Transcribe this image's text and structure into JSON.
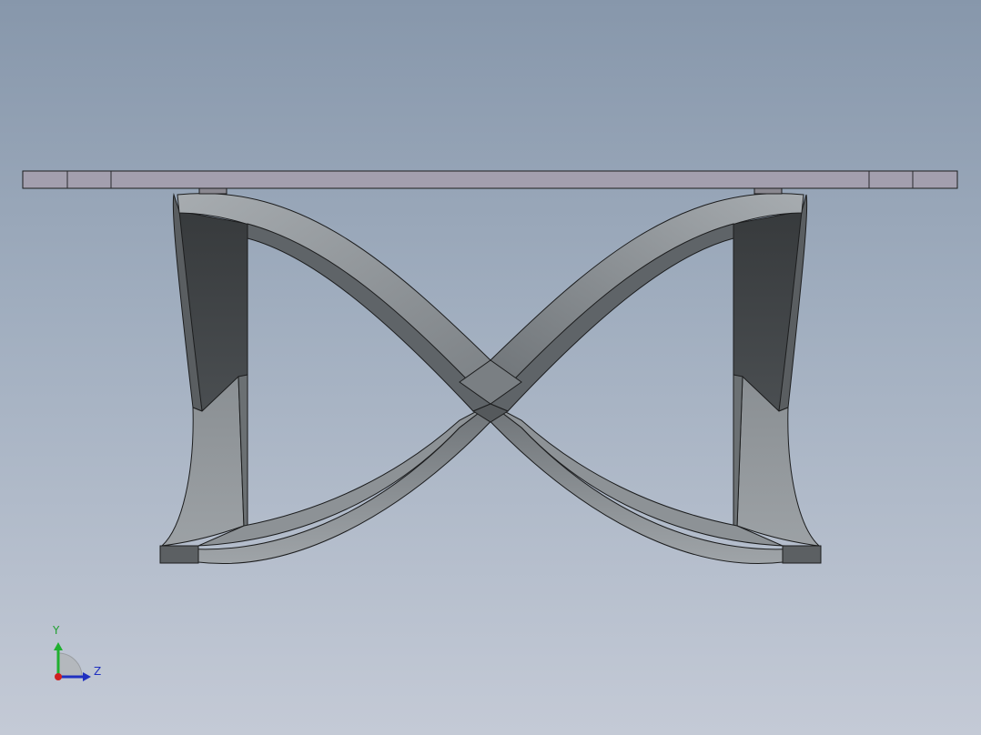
{
  "viewport": {
    "background_top": "#8797ab",
    "background_bottom": "#c4cad6"
  },
  "model": {
    "name": "table",
    "top_color": "#a39fae",
    "base_light": "#a3a8ac",
    "base_dark": "#3b3e40",
    "edge_color": "#1a1a1a"
  },
  "triad": {
    "y_label": "Y",
    "z_label": "Z",
    "y_color": "#20b030",
    "z_color": "#2030c0",
    "origin_color": "#d02020"
  }
}
